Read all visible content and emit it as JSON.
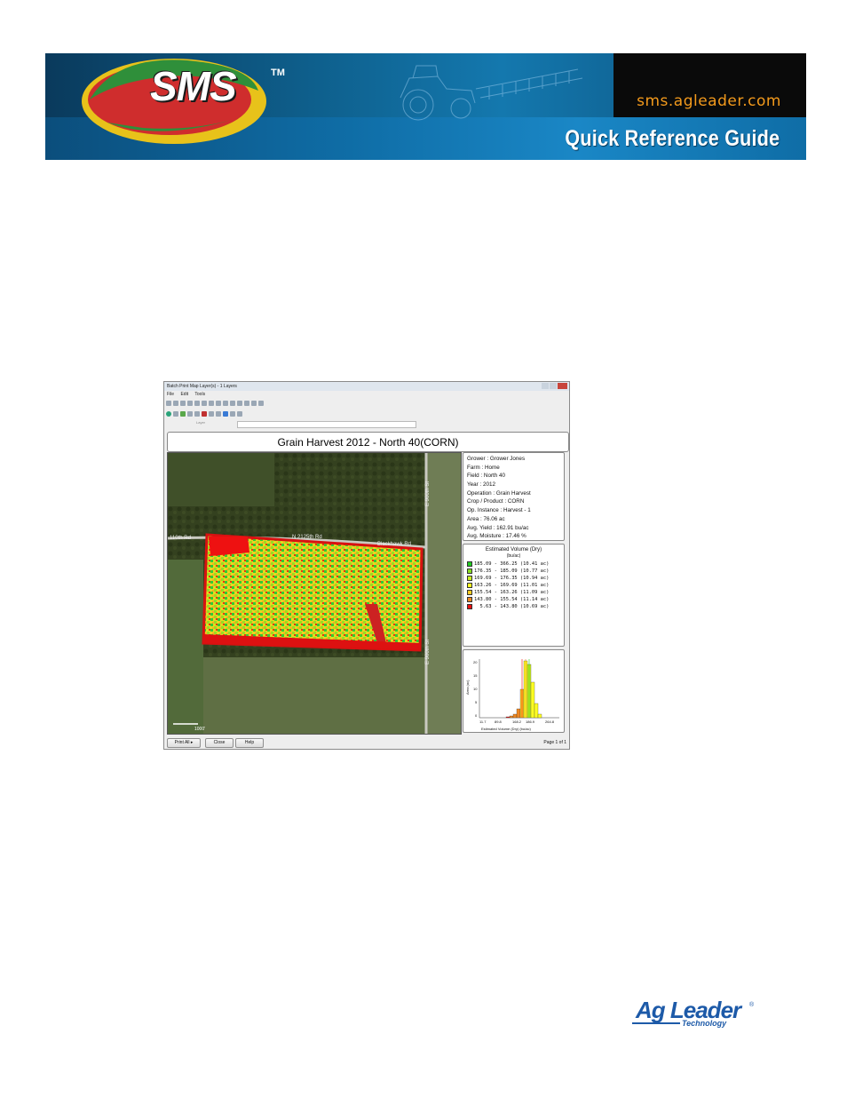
{
  "header": {
    "logo_text": "SMS",
    "logo_tm": "TM",
    "url": "sms.agleader.com",
    "guide_title": "Quick Reference Guide"
  },
  "window": {
    "title": "Batch Print Map Layer(s) - 1 Layers",
    "menus": [
      "File",
      "Edit",
      "Tools"
    ],
    "layer_label": "Layer",
    "map_title": "Grain Harvest 2012 - North 40(CORN)",
    "info": [
      "Grower : Grower Jones",
      "Farm  : Home",
      "Field  : North 40",
      "Year : 2012",
      "Operation  : Grain Harvest",
      "Crop / Product : CORN",
      "Op. Instance : Harvest - 1",
      "Area : 76.06 ac",
      "Avg. Yield : 162.91 bu/ac",
      "Avg. Moisture : 17.46 %"
    ],
    "legend": {
      "title": "Estimated Volume (Dry)",
      "unit": "(bu/ac)",
      "rows": [
        {
          "label": "185.09 - 366.25 (10.41 ac)",
          "color": "#22cc22"
        },
        {
          "label": "176.35 - 185.09 (10.77 ac)",
          "color": "#88dd22"
        },
        {
          "label": "169.69 - 176.35 (10.94 ac)",
          "color": "#ccee22"
        },
        {
          "label": "163.26 - 169.69 (11.01 ac)",
          "color": "#ffff22"
        },
        {
          "label": "155.54 - 163.26 (11.09 ac)",
          "color": "#ffcc22"
        },
        {
          "label": "143.80 - 155.54 (11.14 ac)",
          "color": "#ee8822"
        },
        {
          "label": "  5.63 - 143.80 (10.69 ac)",
          "color": "#ee1111"
        }
      ]
    },
    "histogram": {
      "ylabel": "Area (ac)",
      "xlabel": "Estimated Volume (Dry) (bu/ac)",
      "yticks": [
        "20",
        "15",
        "10",
        "5",
        "0"
      ],
      "xticks": [
        "11.7",
        "89.8",
        "168.2",
        "186.9",
        "264.8"
      ]
    },
    "road_labels": [
      "110th Rd",
      "N 2125th Rd",
      "Blackhawk Rd",
      "E 900th St",
      "E 900th St"
    ],
    "scale_label": "1000'",
    "buttons": {
      "print_all": "Print All",
      "close": "Close",
      "help": "Help"
    },
    "page_label": "Page 1 of 1"
  },
  "footer": {
    "brand": "Ag Leader",
    "sub": "Technology",
    "reg": "®"
  },
  "colors": {
    "banner_blue": "#0f6da6",
    "url_orange": "#f39a1c",
    "ag_blue": "#1d5aa8"
  }
}
